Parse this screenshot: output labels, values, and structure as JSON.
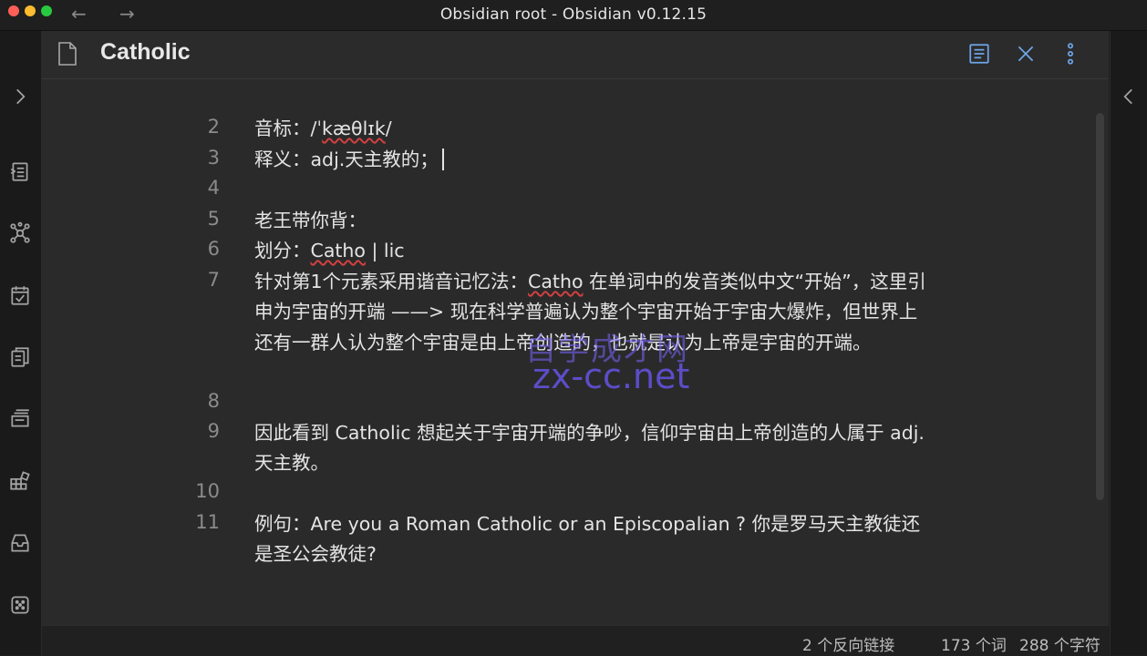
{
  "window": {
    "title": "Obsidian root - Obsidian v0.12.15",
    "back_arrow": "←",
    "forward_arrow": "→"
  },
  "ribbon": {
    "expand_icon": "chevron-right-icon",
    "icons": [
      "switcher-icon",
      "graph-icon",
      "daily-note-icon",
      "templates-icon",
      "slides-icon",
      "community-plugins-icon",
      "archive-icon",
      "random-note-icon"
    ]
  },
  "pane": {
    "title": "Catholic",
    "header_icons": [
      "reading-view-icon",
      "close-icon",
      "more-options-icon"
    ]
  },
  "editor": {
    "lines": [
      {
        "num": "2",
        "segments": [
          {
            "t": "音标：/ˈ"
          },
          {
            "t": "kæθlɪk",
            "spell": true
          },
          {
            "t": "/"
          }
        ]
      },
      {
        "num": "3",
        "segments": [
          {
            "t": "释义：adj.天主教的；"
          }
        ],
        "cursor": true
      },
      {
        "num": "4",
        "segments": [
          {
            "t": ""
          }
        ]
      },
      {
        "num": "5",
        "segments": [
          {
            "t": "老王带你背："
          }
        ]
      },
      {
        "num": "6",
        "segments": [
          {
            "t": "划分："
          },
          {
            "t": "Catho",
            "spell": true
          },
          {
            "t": " | lic"
          }
        ]
      },
      {
        "num": "7",
        "segments": [
          {
            "t": "针对第1个元素采用谐音记忆法："
          },
          {
            "t": "Catho",
            "spell": true
          },
          {
            "t": " 在单词中的发音类似中文“开始”，这里引申为宇宙的开端 ——> 现在科学普遍认为整个宇宙开始于宇宙大爆炸，但世界上还有一群人认为整个宇宙是由上帝创造的，也就是认为上帝是宇宙的开端。"
          }
        ]
      },
      {
        "num": "8",
        "segments": [
          {
            "t": ""
          }
        ]
      },
      {
        "num": "9",
        "segments": [
          {
            "t": "因此看到 Catholic 想起关于宇宙开端的争吵，信仰宇宙由上帝创造的人属于 adj.天主教。"
          }
        ]
      },
      {
        "num": "10",
        "segments": [
          {
            "t": ""
          }
        ]
      },
      {
        "num": "11",
        "segments": [
          {
            "t": "例句：Are you a Roman Catholic or an Episcopalian ? 你是罗马天主教徒还是圣公会教徒?"
          }
        ]
      }
    ]
  },
  "statusbar": {
    "backlinks": "2 个反向链接",
    "words": "173 个词",
    "chars": "288 个字符"
  },
  "watermark": {
    "cn": "自学成才网",
    "en": "zx-cc.net"
  },
  "colors": {
    "background": "#2a2a2a",
    "accent": "#6ea6e8",
    "spell_error": "#d04040"
  }
}
